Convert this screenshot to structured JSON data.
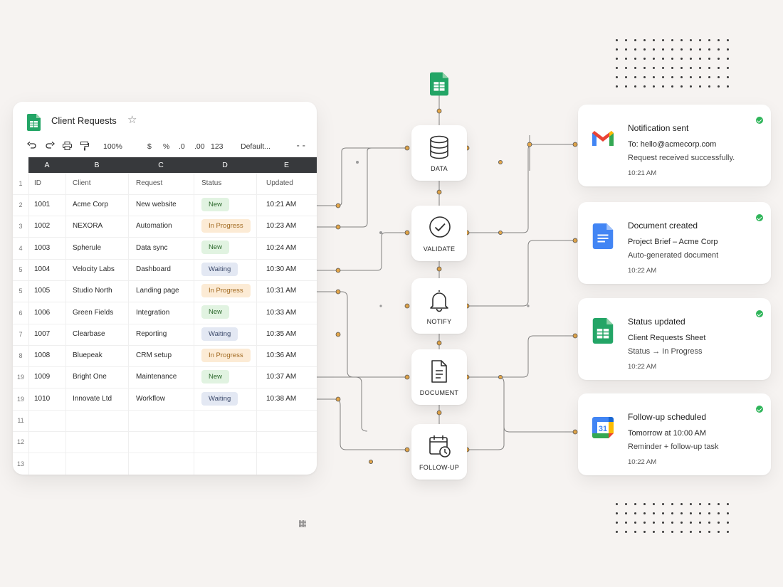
{
  "sheet": {
    "title": "Client Requests",
    "toolbar": {
      "zoom": "100%",
      "currency": "$",
      "percent": "%",
      "dec_decrease": ".0",
      "dec_increase": ".00",
      "number_format": "123",
      "font": "Default..."
    },
    "columns": [
      "A",
      "B",
      "C",
      "D",
      "E"
    ],
    "headers": {
      "row_num": "1",
      "id": "ID",
      "client": "Client",
      "request": "Request",
      "status": "Status",
      "updated": "Updated"
    },
    "rows": [
      {
        "rn": "2",
        "id": "1001",
        "client": "Acme Corp",
        "request": "New website",
        "status": "New",
        "updated": "10:21 AM"
      },
      {
        "rn": "3",
        "id": "1002",
        "client": "NEXORA",
        "request": "Automation",
        "status": "In Progress",
        "updated": "10:23 AM"
      },
      {
        "rn": "4",
        "id": "1003",
        "client": "Spherule",
        "request": "Data sync",
        "status": "New",
        "updated": "10:24 AM"
      },
      {
        "rn": "5",
        "id": "1004",
        "client": "Velocity Labs",
        "request": "Dashboard",
        "status": "Waiting",
        "updated": "10:30 AM"
      },
      {
        "rn": "5",
        "id": "1005",
        "client": "Studio North",
        "request": "Landing page",
        "status": "In Progress",
        "updated": "10:31 AM"
      },
      {
        "rn": "6",
        "id": "1006",
        "client": "Green Fields",
        "request": "Integration",
        "status": "New",
        "updated": "10:33 AM"
      },
      {
        "rn": "7",
        "id": "1007",
        "client": "Clearbase",
        "request": "Reporting",
        "status": "Waiting",
        "updated": "10:35 AM"
      },
      {
        "rn": "8",
        "id": "1008",
        "client": "Bluepeak",
        "request": "CRM setup",
        "status": "In Progress",
        "updated": "10:36 AM"
      },
      {
        "rn": "19",
        "id": "1009",
        "client": "Bright One",
        "request": "Maintenance",
        "status": "New",
        "updated": "10:37 AM"
      },
      {
        "rn": "19",
        "id": "1010",
        "client": "Innovate Ltd",
        "request": "Workflow",
        "status": "Waiting",
        "updated": "10:38 AM"
      }
    ],
    "empty_rows": [
      "11",
      "12",
      "13"
    ]
  },
  "workflow": {
    "nodes": [
      {
        "label": "DATA",
        "icon": "database-icon"
      },
      {
        "label": "VALIDATE",
        "icon": "check-circle-icon"
      },
      {
        "label": "NOTIFY",
        "icon": "bell-icon"
      },
      {
        "label": "DOCUMENT",
        "icon": "document-icon"
      },
      {
        "label": "FOLLOW-UP",
        "icon": "calendar-clock-icon"
      }
    ]
  },
  "cards": [
    {
      "title": "Notification sent",
      "line1": "To: hello@acmecorp.com",
      "line2": "Request received successfully.",
      "time": "10:21 AM",
      "icon": "gmail-icon"
    },
    {
      "title": "Document created",
      "line1": "Project Brief – Acme Corp",
      "line2": "Auto-generated document",
      "time": "10:22 AM",
      "icon": "google-docs-icon"
    },
    {
      "title": "Status updated",
      "line1": "Client Requests Sheet",
      "line2": "Status → In Progress",
      "time": "10:22 AM",
      "icon": "google-sheets-icon"
    },
    {
      "title": "Follow-up scheduled",
      "line1": "Tomorrow at 10:00 AM",
      "line2": "Reminder + follow-up task",
      "time": "10:22 AM",
      "icon": "google-calendar-icon",
      "calendar_day": "31"
    }
  ],
  "colors": {
    "background": "#f6f3f1",
    "header_bar": "#37393c",
    "wire": "#5a5a5a",
    "dot_orange": "#e3a64a",
    "check_green": "#2fb55a",
    "sheets_green": "#23a566",
    "docs_blue": "#4285f4"
  }
}
